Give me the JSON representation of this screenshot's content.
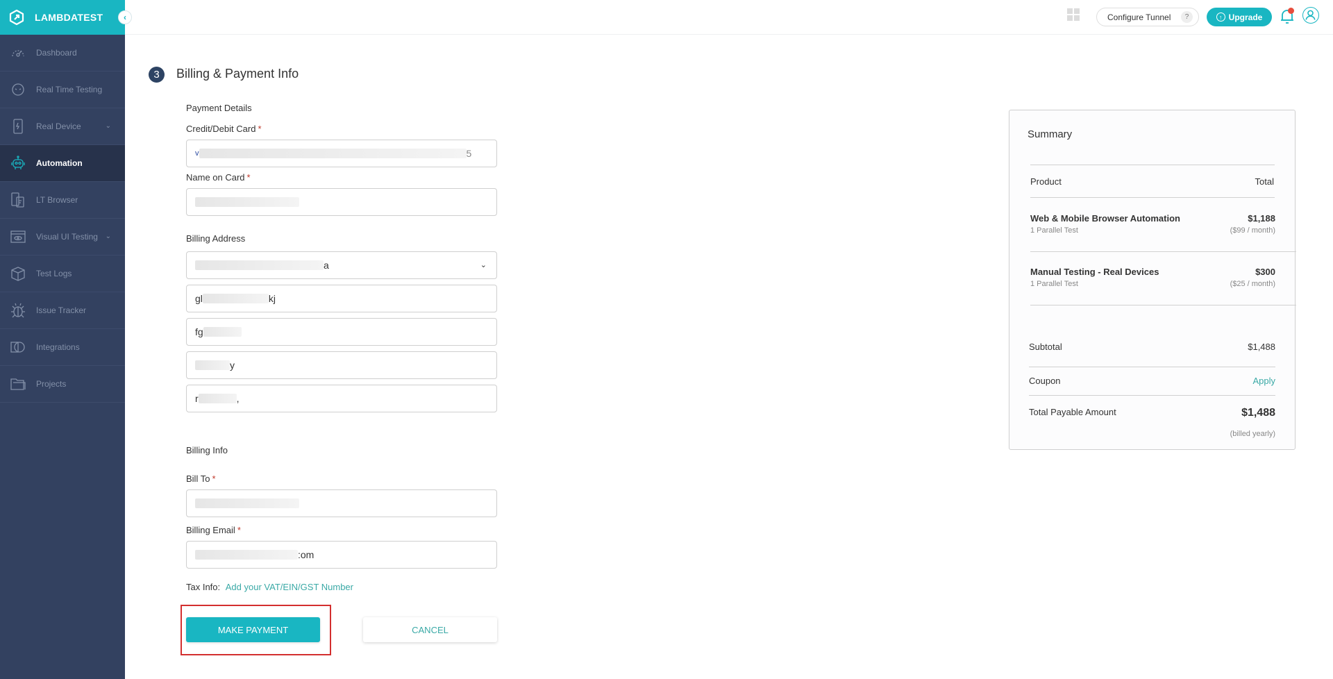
{
  "brand": {
    "name": "LAMBDATEST"
  },
  "sidebar": {
    "items": [
      {
        "label": "Dashboard",
        "icon": "dashboard-icon",
        "has_chevron": false,
        "active": false
      },
      {
        "label": "Real Time Testing",
        "icon": "real-time-icon",
        "has_chevron": false,
        "active": false
      },
      {
        "label": "Real Device",
        "icon": "real-device-icon",
        "has_chevron": true,
        "active": false
      },
      {
        "label": "Automation",
        "icon": "robot-icon",
        "has_chevron": false,
        "active": true
      },
      {
        "label": "LT Browser",
        "icon": "lt-browser-icon",
        "has_chevron": false,
        "active": false
      },
      {
        "label": "Visual UI Testing",
        "icon": "visual-ui-icon",
        "has_chevron": true,
        "active": false
      },
      {
        "label": "Test Logs",
        "icon": "box-icon",
        "has_chevron": false,
        "active": false
      },
      {
        "label": "Issue Tracker",
        "icon": "bug-icon",
        "has_chevron": false,
        "active": false
      },
      {
        "label": "Integrations",
        "icon": "integrations-icon",
        "has_chevron": false,
        "active": false
      },
      {
        "label": "Projects",
        "icon": "folder-icon",
        "has_chevron": false,
        "active": false
      }
    ],
    "collapse_glyph": "‹"
  },
  "topbar": {
    "configure_tunnel": "Configure Tunnel",
    "help_glyph": "?",
    "upgrade": "Upgrade",
    "upgrade_glyph": "↑"
  },
  "page": {
    "step_number": "3",
    "title": "Billing & Payment Info"
  },
  "form": {
    "payment_details_heading": "Payment Details",
    "card_label": "Credit/Debit Card",
    "card_value_start": "v",
    "card_value_end": "5",
    "name_label": "Name on Card",
    "billing_address_heading": "Billing Address",
    "country_value_end": "a",
    "address1_prefix": "gl",
    "address1_suffix": "kj",
    "address2_prefix": "fg",
    "address3_suffix": "y",
    "address4_prefix": "r",
    "address4_suffix": ",",
    "billing_info_heading": "Billing Info",
    "bill_to_label": "Bill To",
    "billing_email_label": "Billing Email",
    "billing_email_suffix": ":om",
    "required_mark": "*",
    "tax_info_label": "Tax Info:",
    "tax_info_link": "Add your VAT/EIN/GST Number",
    "make_payment": "MAKE PAYMENT",
    "cancel": "CANCEL",
    "chevron_glyph": "⌄"
  },
  "summary": {
    "title": "Summary",
    "col_product": "Product",
    "col_total": "Total",
    "items": [
      {
        "name": "Web & Mobile Browser Automation",
        "detail": "1 Parallel Test",
        "price": "$1,188",
        "per_month": "($99 / month)"
      },
      {
        "name": "Manual Testing - Real Devices",
        "detail": "1 Parallel Test",
        "price": "$300",
        "per_month": "($25 / month)"
      }
    ],
    "subtotal_label": "Subtotal",
    "subtotal_value": "$1,488",
    "coupon_label": "Coupon",
    "coupon_action": "Apply",
    "total_label": "Total Payable Amount",
    "total_value": "$1,488",
    "billing_note": "(billed yearly)"
  },
  "colors": {
    "brand_teal": "#19b6c2",
    "sidebar_bg": "#334160",
    "sidebar_active": "#27324b",
    "link": "#3aa9a6",
    "highlight": "#d32f2f"
  }
}
